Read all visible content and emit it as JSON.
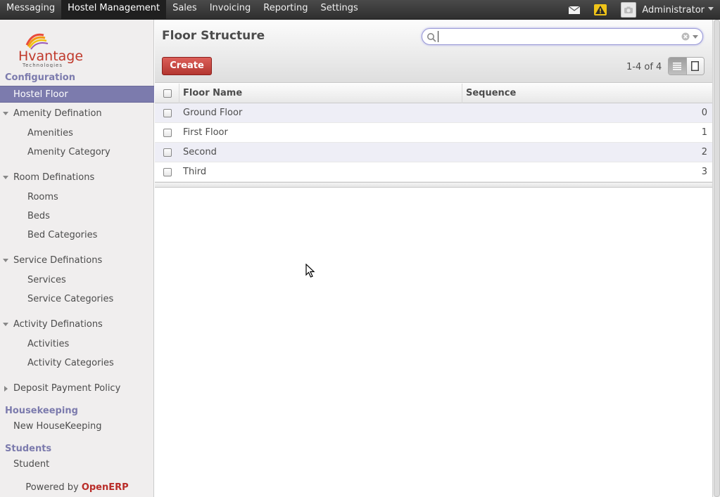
{
  "topbar": {
    "menu": [
      "Messaging",
      "Hostel Management",
      "Sales",
      "Invoicing",
      "Reporting",
      "Settings"
    ],
    "active_menu": "Hostel Management",
    "user": "Administrator"
  },
  "sidebar": {
    "logo_text": "Hvantage",
    "logo_sub": "Technologies",
    "sections": [
      {
        "title": "Configuration"
      },
      {
        "title": "Housekeeping"
      },
      {
        "title": "Students"
      }
    ],
    "items": {
      "hostel_floor": "Hostel Floor",
      "amenity_defination": "Amenity Defination",
      "amenities": "Amenities",
      "amenity_category": "Amenity Category",
      "room_definations": "Room Definations",
      "rooms": "Rooms",
      "beds": "Beds",
      "bed_categories": "Bed Categories",
      "service_definations": "Service Definations",
      "services": "Services",
      "service_categories": "Service Categories",
      "activity_definations": "Activity Definations",
      "activities": "Activities",
      "activity_categories": "Activity Categories",
      "deposit_payment_policy": "Deposit Payment Policy",
      "new_housekeeping": "New HouseKeeping",
      "student": "Student"
    },
    "powered_by": "Powered by",
    "powered_brand": "OpenERP"
  },
  "main": {
    "title": "Floor Structure",
    "search": {
      "value": "",
      "placeholder": ""
    },
    "create_label": "Create",
    "pager": "1-4 of 4",
    "columns": {
      "name": "Floor Name",
      "sequence": "Sequence"
    },
    "rows": [
      {
        "name": "Ground Floor",
        "sequence": "0"
      },
      {
        "name": "First Floor",
        "sequence": "1"
      },
      {
        "name": "Second",
        "sequence": "2"
      },
      {
        "name": "Third",
        "sequence": "3"
      }
    ]
  },
  "colors": {
    "accent": "#7c7bad",
    "create": "#c9302c",
    "topbar": "#3a3a3a"
  }
}
